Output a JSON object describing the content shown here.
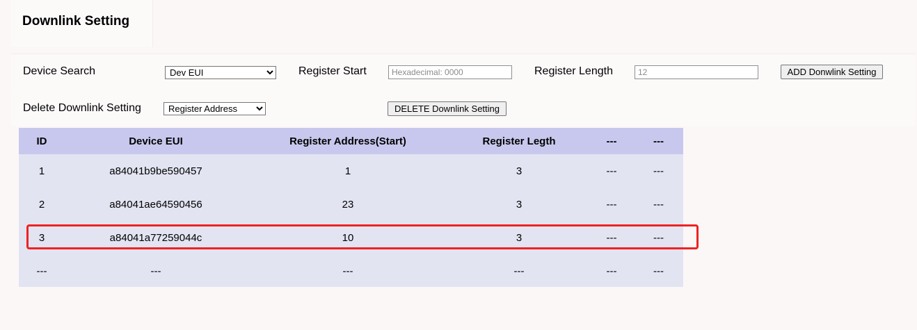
{
  "page": {
    "title": "Downlink Setting"
  },
  "form": {
    "device_search_label": "Device Search",
    "device_search_selected": "Dev EUI",
    "register_start_label": "Register Start",
    "register_start_placeholder": "Hexadecimal: 0000",
    "register_length_label": "Register Length",
    "register_length_placeholder": "12",
    "add_button": "ADD Donwlink Setting",
    "delete_label": "Delete Downlink Setting",
    "delete_selected": "Register Address",
    "delete_button": "DELETE Downlink Setting"
  },
  "table": {
    "headers": [
      "ID",
      "Device EUI",
      "Register Address(Start)",
      "Register Legth",
      "---",
      "---"
    ],
    "rows": [
      [
        "1",
        "a84041b9be590457",
        "1",
        "3",
        "---",
        "---"
      ],
      [
        "2",
        "a84041ae64590456",
        "23",
        "3",
        "---",
        "---"
      ],
      [
        "3",
        "a84041a77259044c",
        "10",
        "3",
        "---",
        "---"
      ],
      [
        "---",
        "---",
        "---",
        "---",
        "---",
        "---"
      ]
    ]
  },
  "annotation": {
    "highlight_color": "#ee2222",
    "highlighted_row": 3
  }
}
